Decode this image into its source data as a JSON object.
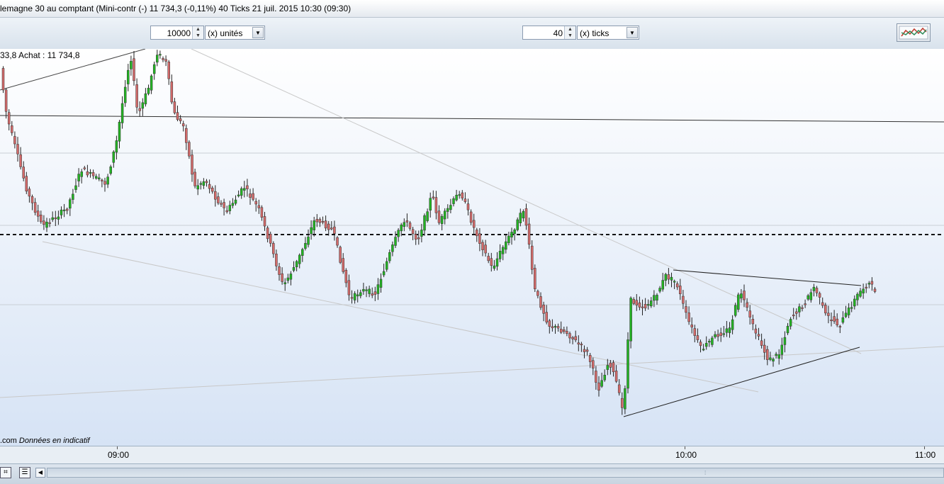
{
  "window": {
    "title": "lemagne 30 au comptant (Mini-contr (-)    11 734,3 (-0,11%)    40 Ticks  21 juil. 2015 10:30 (09:30)"
  },
  "toolbar": {
    "quantity_value": "10000",
    "quantity_unit": "(x) unités",
    "ticks_value": "40",
    "ticks_unit": "(x) ticks",
    "indicator_icon": "chart-indicators-icon"
  },
  "chart": {
    "info_label": "33,8 Achat : 11 734,8",
    "footer_source": ".com",
    "footer_note": "Données en indicatif",
    "colors": {
      "up": "#22b422",
      "down": "#d36a6a",
      "background_top": "#ffffff",
      "background_bottom": "#d6e3f5"
    }
  },
  "time_axis": {
    "labels": [
      "09:00",
      "10:00",
      "11:00"
    ]
  },
  "bottombar": {
    "icons": [
      "crosshair-icon",
      "grid-icon",
      "scroll-left-icon"
    ]
  }
}
